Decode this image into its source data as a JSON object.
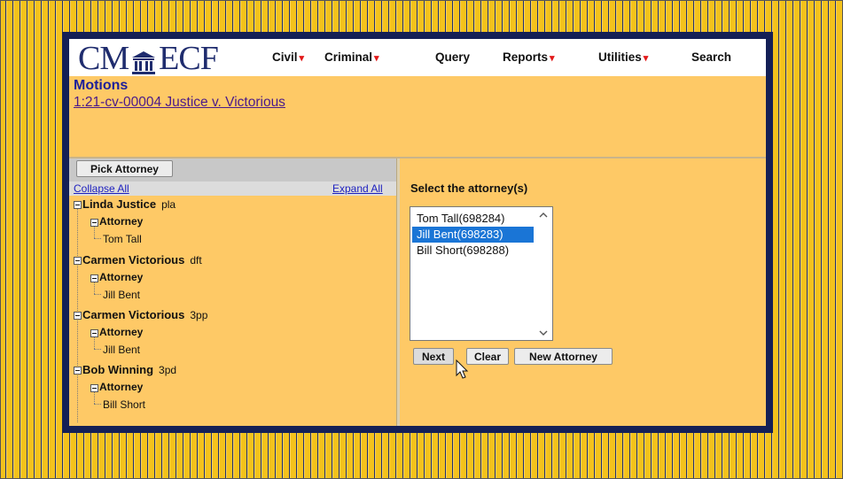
{
  "header": {
    "logo_left": "CM",
    "logo_right": "ECF",
    "menu": [
      {
        "label": "Civil",
        "dropdown": true
      },
      {
        "label": "Criminal",
        "dropdown": true
      },
      {
        "label": "Query",
        "dropdown": false
      },
      {
        "label": "Reports",
        "dropdown": true
      },
      {
        "label": "Utilities",
        "dropdown": true
      },
      {
        "label": "Search",
        "dropdown": false
      }
    ]
  },
  "page": {
    "title": "Motions",
    "case_link": "1:21-cv-00004 Justice v. Victorious"
  },
  "left_panel": {
    "pick_button": "Pick Attorney",
    "collapse_all": "Collapse All",
    "expand_all": "Expand All",
    "parties": [
      {
        "name": "Linda Justice",
        "role": "pla",
        "group": "Attorney",
        "attorney": "Tom Tall"
      },
      {
        "name": "Carmen Victorious",
        "role": "dft",
        "group": "Attorney",
        "attorney": "Jill Bent"
      },
      {
        "name": "Carmen Victorious",
        "role": "3pp",
        "group": "Attorney",
        "attorney": "Jill Bent"
      },
      {
        "name": "Bob Winning",
        "role": "3pd",
        "group": "Attorney",
        "attorney": "Bill Short"
      }
    ]
  },
  "right_panel": {
    "select_label": "Select the attorney(s)",
    "options": [
      {
        "label": "Tom Tall(698284)",
        "selected": false
      },
      {
        "label": "Jill Bent(698283)",
        "selected": true
      },
      {
        "label": "Bill Short(698288)",
        "selected": false
      }
    ],
    "buttons": {
      "next": "Next",
      "clear": "Clear",
      "new_attorney": "New Attorney"
    }
  },
  "colors": {
    "accent": "#1f2c6e",
    "panel": "#fec966",
    "selection": "#1a75d6",
    "caret": "#e21a1a"
  }
}
